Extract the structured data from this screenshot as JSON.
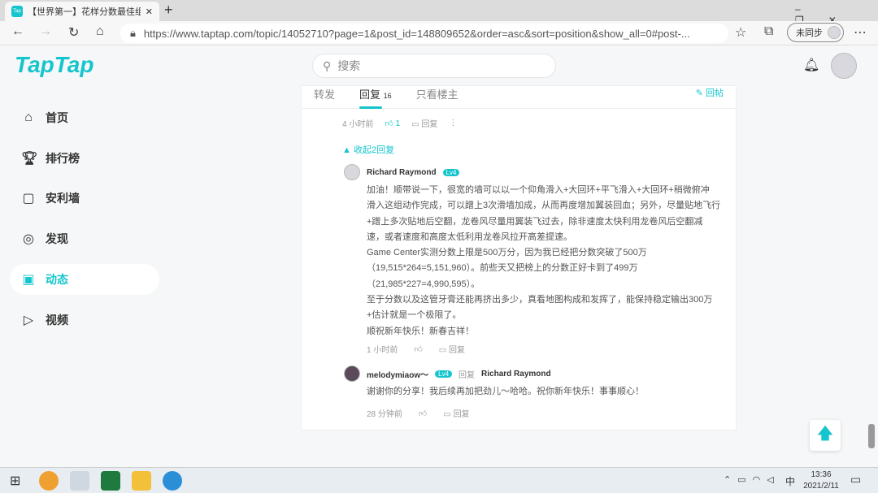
{
  "browser": {
    "tab_title": "【世界第一】花样分数最佳组合",
    "url": "https://www.taptap.com/topic/14052710?page=1&post_id=148809652&order=asc&sort=position&show_all=0#post-...",
    "sync": "未同步",
    "favicon": "Tap"
  },
  "header": {
    "logo": "TapTap",
    "search_placeholder": "搜索"
  },
  "sidebar": {
    "items": [
      {
        "label": "首页",
        "icon": "home-icon"
      },
      {
        "label": "排行榜",
        "icon": "trophy-icon"
      },
      {
        "label": "安利墙",
        "icon": "badge-icon"
      },
      {
        "label": "发现",
        "icon": "discover-icon"
      },
      {
        "label": "动态",
        "icon": "chat-icon"
      },
      {
        "label": "视频",
        "icon": "video-icon"
      }
    ]
  },
  "tabs": {
    "forward": "转发",
    "reply": "回复",
    "reply_count": "16",
    "owner_only": "只看楼主",
    "post_reply": "回帖"
  },
  "top_meta": {
    "time": "4 小时前",
    "likes": "1",
    "reply": "回复"
  },
  "collapse": "收起2回复",
  "replies": [
    {
      "user": "Richard Raymond",
      "level": "Lv4",
      "lines": [
        "加油！顺带说一下，很宽的墙可以以一个仰角滑入+大回环+平飞滑入+大回环+稍微俯冲",
        "滑入这组动作完成，可以蹭上3次滑墙加成，从而再度增加翼装回血；另外，尽量贴地飞行",
        "+蹭上多次贴地后空翻，龙卷风尽量用翼装飞过去，除非速度太快利用龙卷风后空翻减",
        "速，或者速度和高度太低利用龙卷风拉开高差提速。",
        "Game Center实测分数上限是500万分，因为我已经把分数突破了500万",
        "（19,515*264=5,151,960）。前些天又把榜上的分数正好卡到了499万",
        "（21,985*227=4,990,595）。",
        "至于分数以及这管牙膏还能再挤出多少，真看地图构成和发挥了，能保持稳定输出300万",
        "+估计就是一个极限了。",
        "顺祝新年快乐！新春吉祥！"
      ],
      "time": "1 小时前",
      "reply": "回复"
    },
    {
      "user": "melodymiaow～",
      "level": "Lv4",
      "reply_word": "回复",
      "reply_to": "Richard Raymond",
      "lines": [
        "谢谢你的分享！我后续再加把劲儿～哈哈。祝你新年快乐！事事顺心！"
      ],
      "time": "28 分钟前",
      "reply": "回复"
    }
  ],
  "taskbar": {
    "time": "13:36",
    "date": "2021/2/11",
    "ime": "中"
  }
}
